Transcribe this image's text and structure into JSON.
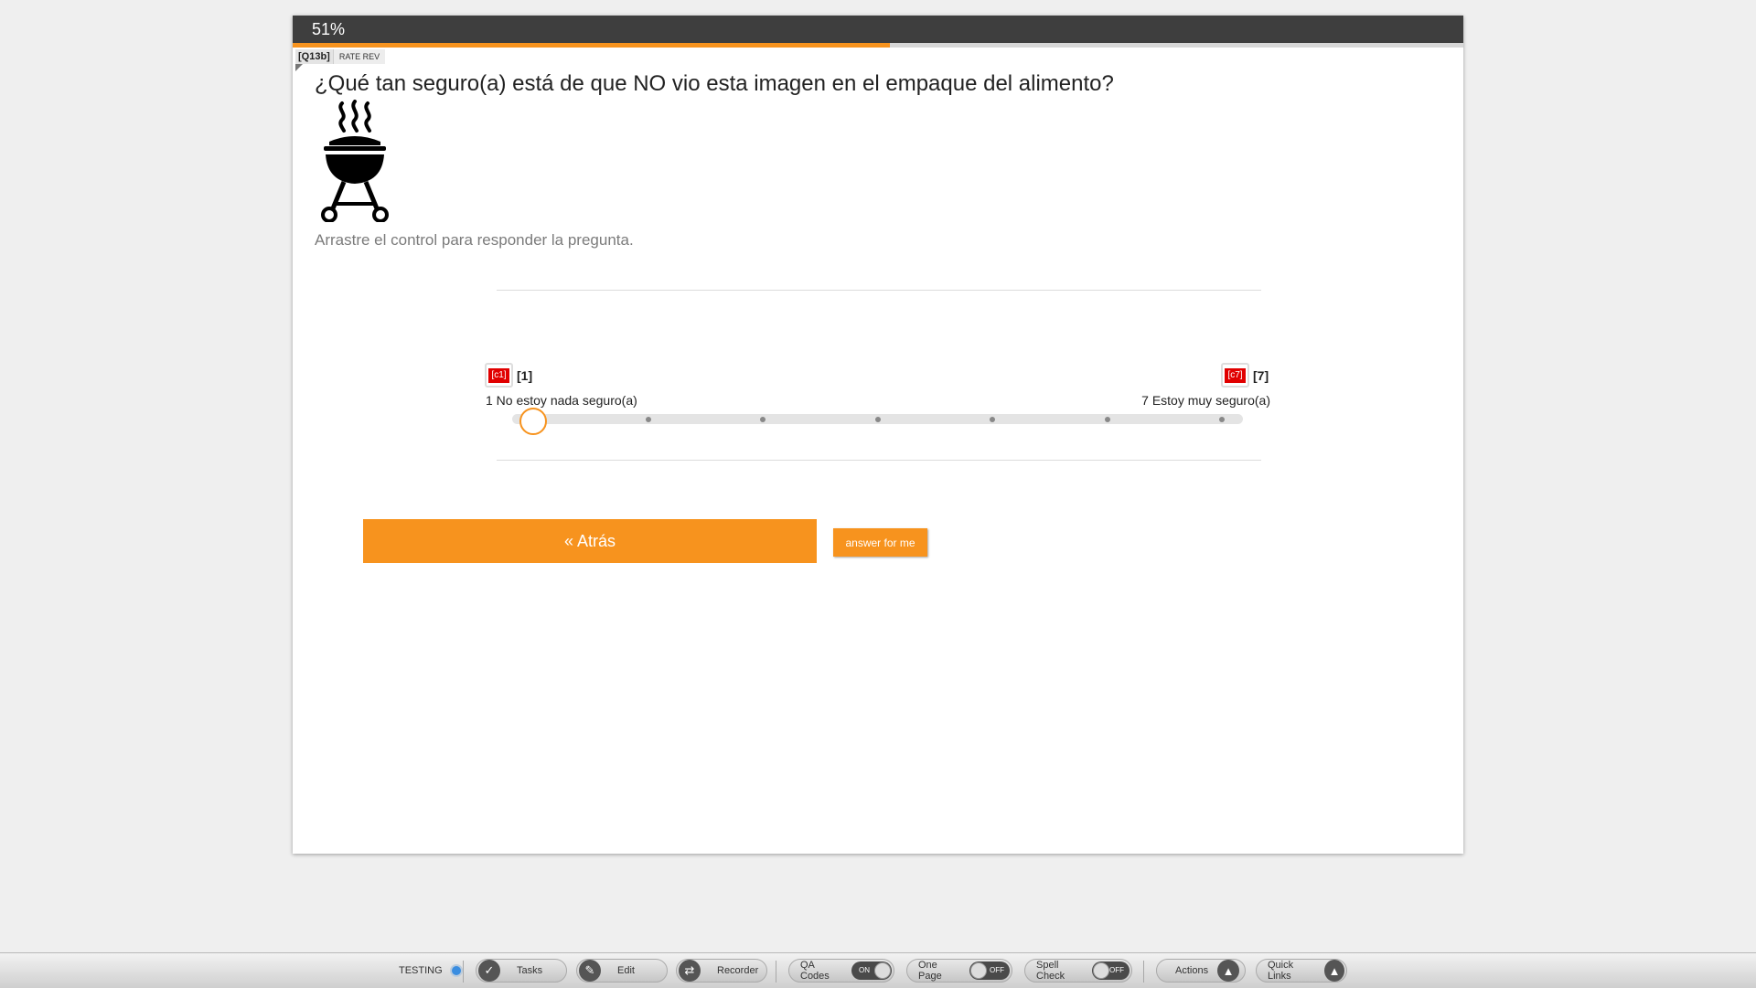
{
  "progress": {
    "label": "51%",
    "fraction": 0.51
  },
  "question": {
    "code": "[Q13b]",
    "type": "RATE REV",
    "text": "¿Qué tan seguro(a) está de que NO vio esta imagen en el empaque del alimento?",
    "image_icon": "barbecue-grill-icon",
    "instruction": "Arrastre el control para responder la pregunta."
  },
  "scale": {
    "left": {
      "code": "[c1]",
      "value": "[1]",
      "label": "1 No estoy nada seguro(a)"
    },
    "right": {
      "code": "[c7]",
      "value": "[7]",
      "label": "7 Estoy muy seguro(a)"
    },
    "min": 1,
    "max": 7,
    "selected": 1
  },
  "buttons": {
    "back": "« Atrás",
    "answer_for_me": "answer for me"
  },
  "toolbar": {
    "status": "TESTING",
    "tasks": "Tasks",
    "edit": "Edit",
    "recorder": "Recorder",
    "qa_codes": "QA Codes",
    "qa_codes_state": "ON",
    "one_page": "One Page",
    "one_page_state": "OFF",
    "spell_check": "Spell Check",
    "spell_check_state": "OFF",
    "actions": "Actions",
    "quick_links": "Quick Links"
  },
  "colors": {
    "accent": "#f7931e",
    "header": "#3e3e3e",
    "code_badge": "#e10000"
  }
}
